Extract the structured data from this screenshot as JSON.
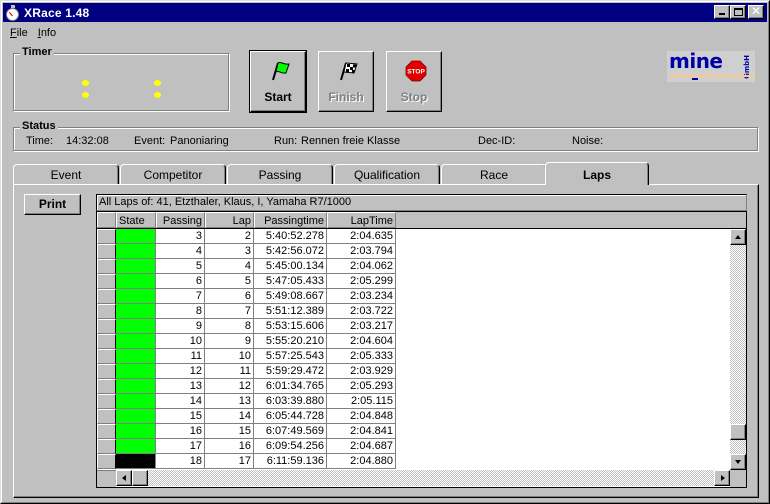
{
  "window": {
    "title": "XRace 1.48",
    "app_icon": "stopwatch-icon",
    "controls": [
      "minimize",
      "maximize",
      "close"
    ]
  },
  "menu": [
    {
      "label": "File",
      "accel": "F"
    },
    {
      "label": "Info",
      "accel": "I"
    }
  ],
  "timer": {
    "label": "Timer",
    "display_color": "#ffff00"
  },
  "buttons": {
    "start": {
      "label": "Start",
      "icon": "green-flag-icon",
      "enabled": true
    },
    "finish": {
      "label": "Finish",
      "icon": "checkered-flag-icon",
      "enabled": false
    },
    "stop": {
      "label": "Stop",
      "icon": "stop-sign-icon",
      "icon_text": "STOP",
      "enabled": false
    }
  },
  "logo": {
    "text": "mine",
    "suffix": "GmbH",
    "color": "#0000a8"
  },
  "status": {
    "label": "Status",
    "time_label": "Time:",
    "time_value": "14:32:08",
    "event_label": "Event:",
    "event_value": "Panoniaring",
    "run_label": "Run:",
    "run_value": "Rennen freie Klasse",
    "dec_id_label": "Dec-ID:",
    "dec_id_value": "",
    "noise_label": "Noise:",
    "noise_value": ""
  },
  "tabs": [
    {
      "label": "Event",
      "active": false
    },
    {
      "label": "Competitor",
      "active": false
    },
    {
      "label": "Passing",
      "active": false
    },
    {
      "label": "Qualification",
      "active": false
    },
    {
      "label": "Race",
      "active": false
    },
    {
      "label": "Laps",
      "active": true
    }
  ],
  "laps": {
    "print_label": "Print",
    "caption": "All Laps of: 41, Etzthaler, Klaus, I, Yamaha R7/1000",
    "columns": [
      "State",
      "Passing",
      "Lap",
      "Passingtime",
      "LapTime"
    ],
    "state_colors": {
      "ok": "#00ff00",
      "current": "#000000"
    },
    "rows": [
      {
        "state": "ok",
        "passing": "3",
        "lap": "2",
        "passingtime": "5:40:52.278",
        "laptime": "2:04.635"
      },
      {
        "state": "ok",
        "passing": "4",
        "lap": "3",
        "passingtime": "5:42:56.072",
        "laptime": "2:03.794"
      },
      {
        "state": "ok",
        "passing": "5",
        "lap": "4",
        "passingtime": "5:45:00.134",
        "laptime": "2:04.062"
      },
      {
        "state": "ok",
        "passing": "6",
        "lap": "5",
        "passingtime": "5:47:05.433",
        "laptime": "2:05.299"
      },
      {
        "state": "ok",
        "passing": "7",
        "lap": "6",
        "passingtime": "5:49:08.667",
        "laptime": "2:03.234"
      },
      {
        "state": "ok",
        "passing": "8",
        "lap": "7",
        "passingtime": "5:51:12.389",
        "laptime": "2:03.722"
      },
      {
        "state": "ok",
        "passing": "9",
        "lap": "8",
        "passingtime": "5:53:15.606",
        "laptime": "2:03.217"
      },
      {
        "state": "ok",
        "passing": "10",
        "lap": "9",
        "passingtime": "5:55:20.210",
        "laptime": "2:04.604"
      },
      {
        "state": "ok",
        "passing": "11",
        "lap": "10",
        "passingtime": "5:57:25.543",
        "laptime": "2:05.333"
      },
      {
        "state": "ok",
        "passing": "12",
        "lap": "11",
        "passingtime": "5:59:29.472",
        "laptime": "2:03.929"
      },
      {
        "state": "ok",
        "passing": "13",
        "lap": "12",
        "passingtime": "6:01:34.765",
        "laptime": "2:05.293"
      },
      {
        "state": "ok",
        "passing": "14",
        "lap": "13",
        "passingtime": "6:03:39.880",
        "laptime": "2:05.115"
      },
      {
        "state": "ok",
        "passing": "15",
        "lap": "14",
        "passingtime": "6:05:44.728",
        "laptime": "2:04.848"
      },
      {
        "state": "ok",
        "passing": "16",
        "lap": "15",
        "passingtime": "6:07:49.569",
        "laptime": "2:04.841"
      },
      {
        "state": "ok",
        "passing": "17",
        "lap": "16",
        "passingtime": "6:09:54.256",
        "laptime": "2:04.687"
      },
      {
        "state": "current",
        "passing": "18",
        "lap": "17",
        "passingtime": "6:11:59.136",
        "laptime": "2:04.880"
      }
    ],
    "vertical_scroll_position": 0.93,
    "horizontal_scroll_position": 0.0
  }
}
